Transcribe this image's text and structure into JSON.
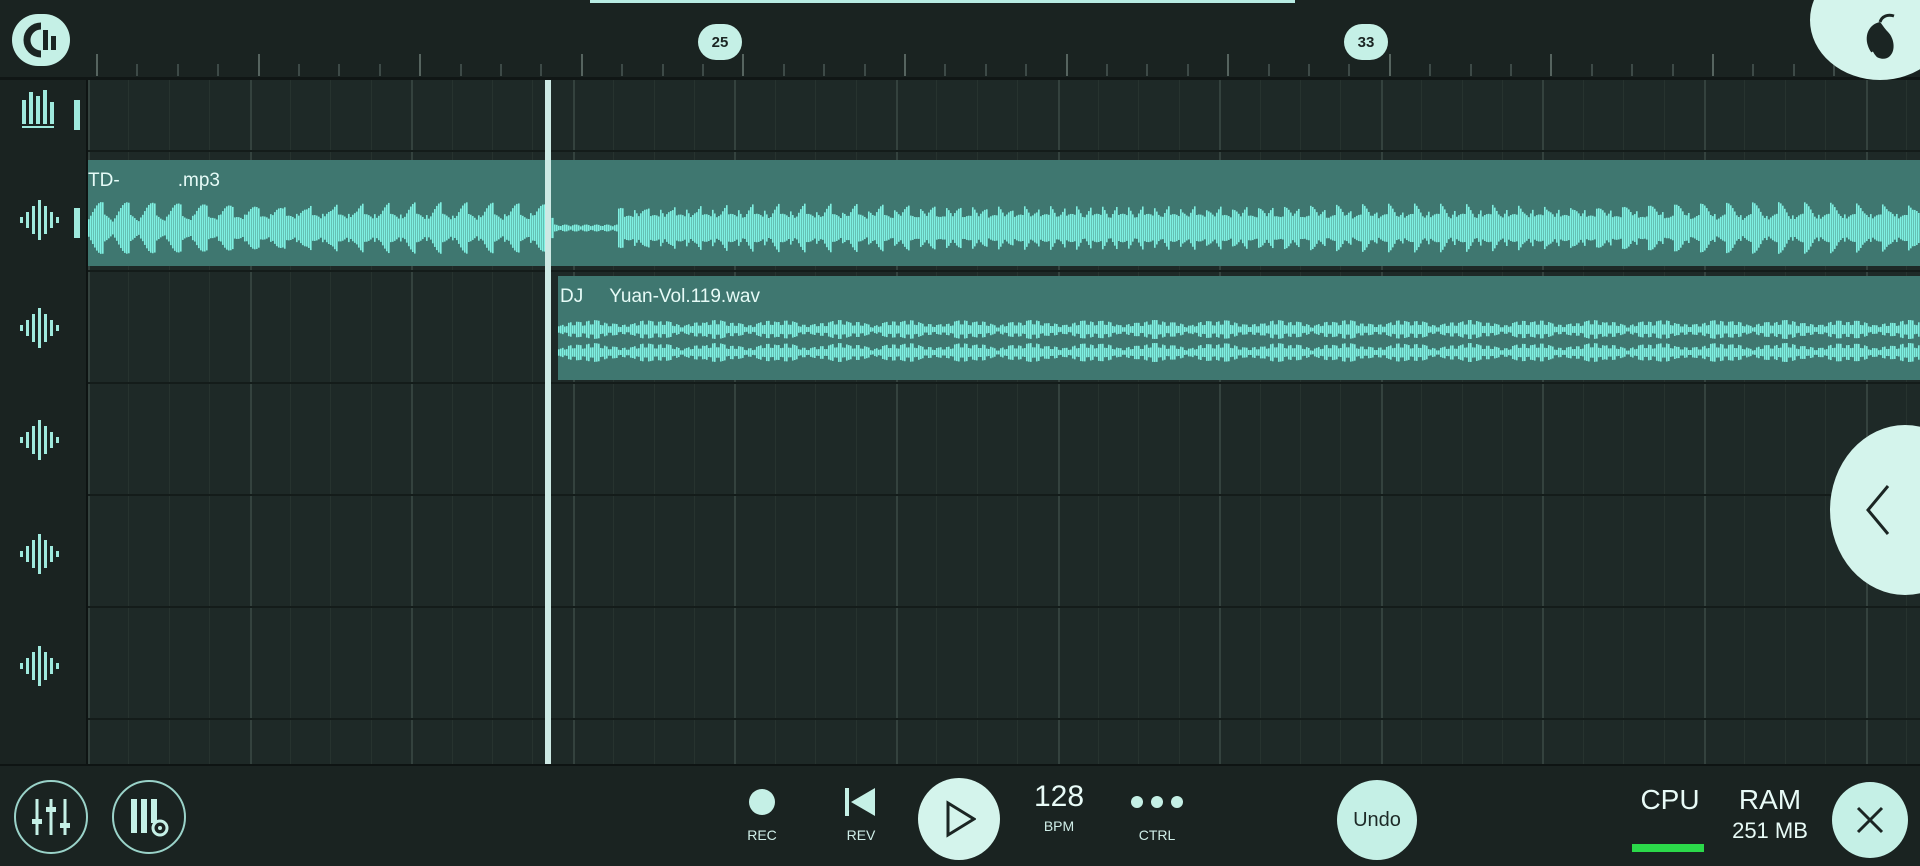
{
  "ruler": {
    "markers": [
      "25",
      "33"
    ]
  },
  "header": {
    "logo_icon": "fl-studio-mobile-logo",
    "corner_icon": "fl-fruit-icon"
  },
  "tracks": {
    "icons": [
      "mixer-levels-icon",
      "audio-waveform-icon",
      "audio-waveform-icon",
      "audio-waveform-icon",
      "audio-waveform-icon",
      "audio-waveform-icon"
    ]
  },
  "clips": [
    {
      "label": "TD-           .mp3"
    },
    {
      "label": "DJ     Yuan-Vol.119.wav"
    }
  ],
  "transport": {
    "rec_label": "REC",
    "rev_label": "REV",
    "bpm_value": "128",
    "bpm_label": "BPM",
    "ctrl_label": "CTRL",
    "undo_label": "Undo",
    "cpu_label": "CPU",
    "ram_label": "RAM",
    "ram_value": "251 MB",
    "cpu_level": 0.9
  },
  "colors": {
    "accent": "#c5f0e6",
    "clip": "#3f7770",
    "waveform": "#7ff0e2",
    "cpu_meter": "#2bd94a"
  }
}
